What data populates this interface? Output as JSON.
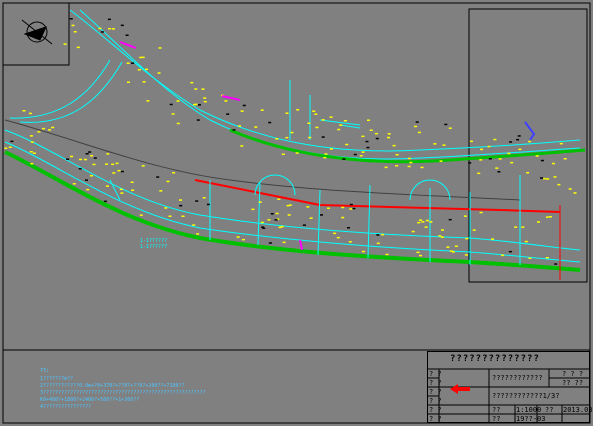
{
  "title_block": {
    "main_title": "??????????????",
    "row1_left_a": "? ?",
    "row1_left_b": "? ?",
    "row1_mid": "????????????",
    "row1_right_a": "? ?  ?",
    "row1_right_b": "??  ??",
    "row2_left_a": "? ?",
    "row2_left_b": "? ?",
    "row2_sub": "????????????1/3?",
    "row3_left": "? ?",
    "scale_label": "??",
    "scale_value": "1:1000",
    "date_label": "??",
    "date_value": "2013.03",
    "row4_left": "? ?",
    "drawno_label": "??",
    "drawno_value": "19??-03"
  },
  "notes": {
    "heading": "??:",
    "lines": [
      "1???????m??",
      "2????????????0.0m+?0+370?+??0?+??0?+200??+7100??",
      "3??????????????????????????????????????????????????????",
      "  K0+480?+1800?+2400?+500??+1+360??",
      "4????????????????"
    ]
  },
  "drawing": {
    "left_labels": [
      "1-1??????",
      "1-1??????"
    ],
    "legend_title": "?????"
  },
  "colors": {
    "background": "#808080",
    "road": "#00ffff",
    "green": "#00c000",
    "yellow": "#ffff00",
    "red": "#ff0000",
    "magenta": "#ff00ff"
  }
}
